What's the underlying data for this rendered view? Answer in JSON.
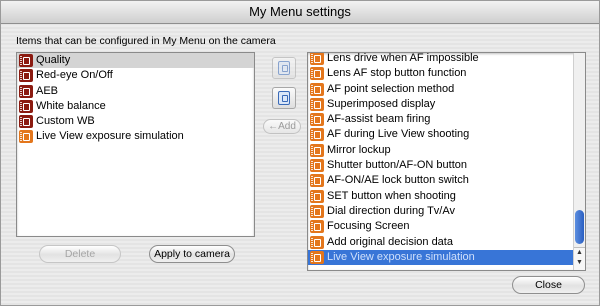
{
  "window": {
    "title": "My Menu settings"
  },
  "caption": "Items that can be configured in My Menu on the camera",
  "left_list": {
    "items": [
      {
        "label": "Quality",
        "icon": "camera-red-icon",
        "state": "selected"
      },
      {
        "label": "Red-eye On/Off",
        "icon": "camera-red-icon",
        "state": ""
      },
      {
        "label": "AEB",
        "icon": "camera-red-icon",
        "state": ""
      },
      {
        "label": "White balance",
        "icon": "camera-red-icon",
        "state": ""
      },
      {
        "label": "Custom WB",
        "icon": "camera-red-icon",
        "state": ""
      },
      {
        "label": "Live View exposure simulation",
        "icon": "settings-orange-icon",
        "state": ""
      }
    ]
  },
  "middle": {
    "add_label": "←Add"
  },
  "right_list": {
    "items": [
      {
        "label": "Lens drive when AF impossible",
        "icon": "settings-orange-icon",
        "state": ""
      },
      {
        "label": "Lens AF stop button function",
        "icon": "settings-orange-icon",
        "state": ""
      },
      {
        "label": "AF point selection method",
        "icon": "settings-orange-icon",
        "state": ""
      },
      {
        "label": "Superimposed display",
        "icon": "settings-orange-icon",
        "state": ""
      },
      {
        "label": "AF-assist beam firing",
        "icon": "settings-orange-icon",
        "state": ""
      },
      {
        "label": "AF during Live View shooting",
        "icon": "settings-orange-icon",
        "state": ""
      },
      {
        "label": "Mirror lockup",
        "icon": "settings-orange-icon",
        "state": ""
      },
      {
        "label": "Shutter button/AF-ON button",
        "icon": "settings-orange-icon",
        "state": ""
      },
      {
        "label": "AF-ON/AE lock button switch",
        "icon": "settings-orange-icon",
        "state": ""
      },
      {
        "label": "SET button when shooting",
        "icon": "settings-orange-icon",
        "state": ""
      },
      {
        "label": "Dial direction during Tv/Av",
        "icon": "settings-orange-icon",
        "state": ""
      },
      {
        "label": "Focusing Screen",
        "icon": "settings-orange-icon",
        "state": ""
      },
      {
        "label": "Add original decision data",
        "icon": "settings-orange-icon",
        "state": ""
      },
      {
        "label": "Live View exposure simulation",
        "icon": "settings-orange-icon",
        "state": "active"
      }
    ],
    "scroll_position": 0.88
  },
  "buttons": {
    "delete": "Delete",
    "apply": "Apply to camera",
    "close": "Close"
  },
  "colors": {
    "selection_blue": "#3875d7",
    "icon_red": "#8b1a10",
    "icon_orange": "#e3761c"
  }
}
